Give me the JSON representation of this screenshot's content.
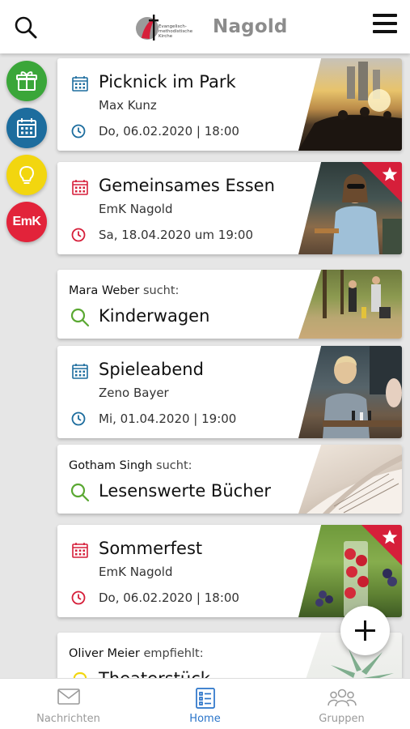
{
  "header": {
    "logo_text": "Evangelisch-methodistische Kirche",
    "city": "Nagold"
  },
  "side_menu": [
    {
      "icon": "gift-icon",
      "color": "#3aa639"
    },
    {
      "icon": "calendar-icon",
      "color": "#1d6d9e"
    },
    {
      "icon": "lightbulb-icon",
      "color": "#f2d60f"
    },
    {
      "icon": "emk-icon",
      "label": "EmK",
      "color": "#e2233a"
    }
  ],
  "cards": {
    "picknick": {
      "title": "Picknick im Park",
      "organizer": "Max Kunz",
      "date": "Do, 06.02.2020 | 18:00",
      "accent": "#1d6d9e"
    },
    "essen": {
      "title": "Gemeinsames Essen",
      "organizer": "EmK Nagold",
      "date": "Sa, 18.04.2020 um 19:00",
      "accent": "#d61f3a",
      "starred": true
    },
    "kinderwagen": {
      "person": "Mara Weber",
      "action": "sucht:",
      "title": "Kinderwagen",
      "accent": "#5aa832"
    },
    "spieleabend": {
      "title": "Spieleabend",
      "organizer": "Zeno Bayer",
      "date": "Mi, 01.04.2020 | 19:00",
      "accent": "#1d6d9e"
    },
    "buecher": {
      "person": "Gotham Singh",
      "action": "sucht:",
      "title": "Lesenswerte Bücher",
      "accent": "#5aa832"
    },
    "sommerfest": {
      "title": "Sommerfest",
      "organizer": "EmK Nagold",
      "date": "Do, 06.02.2020 | 18:00",
      "accent": "#d61f3a",
      "starred": true
    },
    "theater": {
      "person": "Oliver Meier",
      "action": "empfiehlt:",
      "title": "Theaterstück",
      "accent": "#f2d60f"
    }
  },
  "bottom_nav": [
    {
      "label": "Nachrichten",
      "icon": "mail-icon",
      "active": false
    },
    {
      "label": "Home",
      "icon": "list-icon",
      "active": true
    },
    {
      "label": "Gruppen",
      "icon": "group-icon",
      "active": false
    }
  ]
}
